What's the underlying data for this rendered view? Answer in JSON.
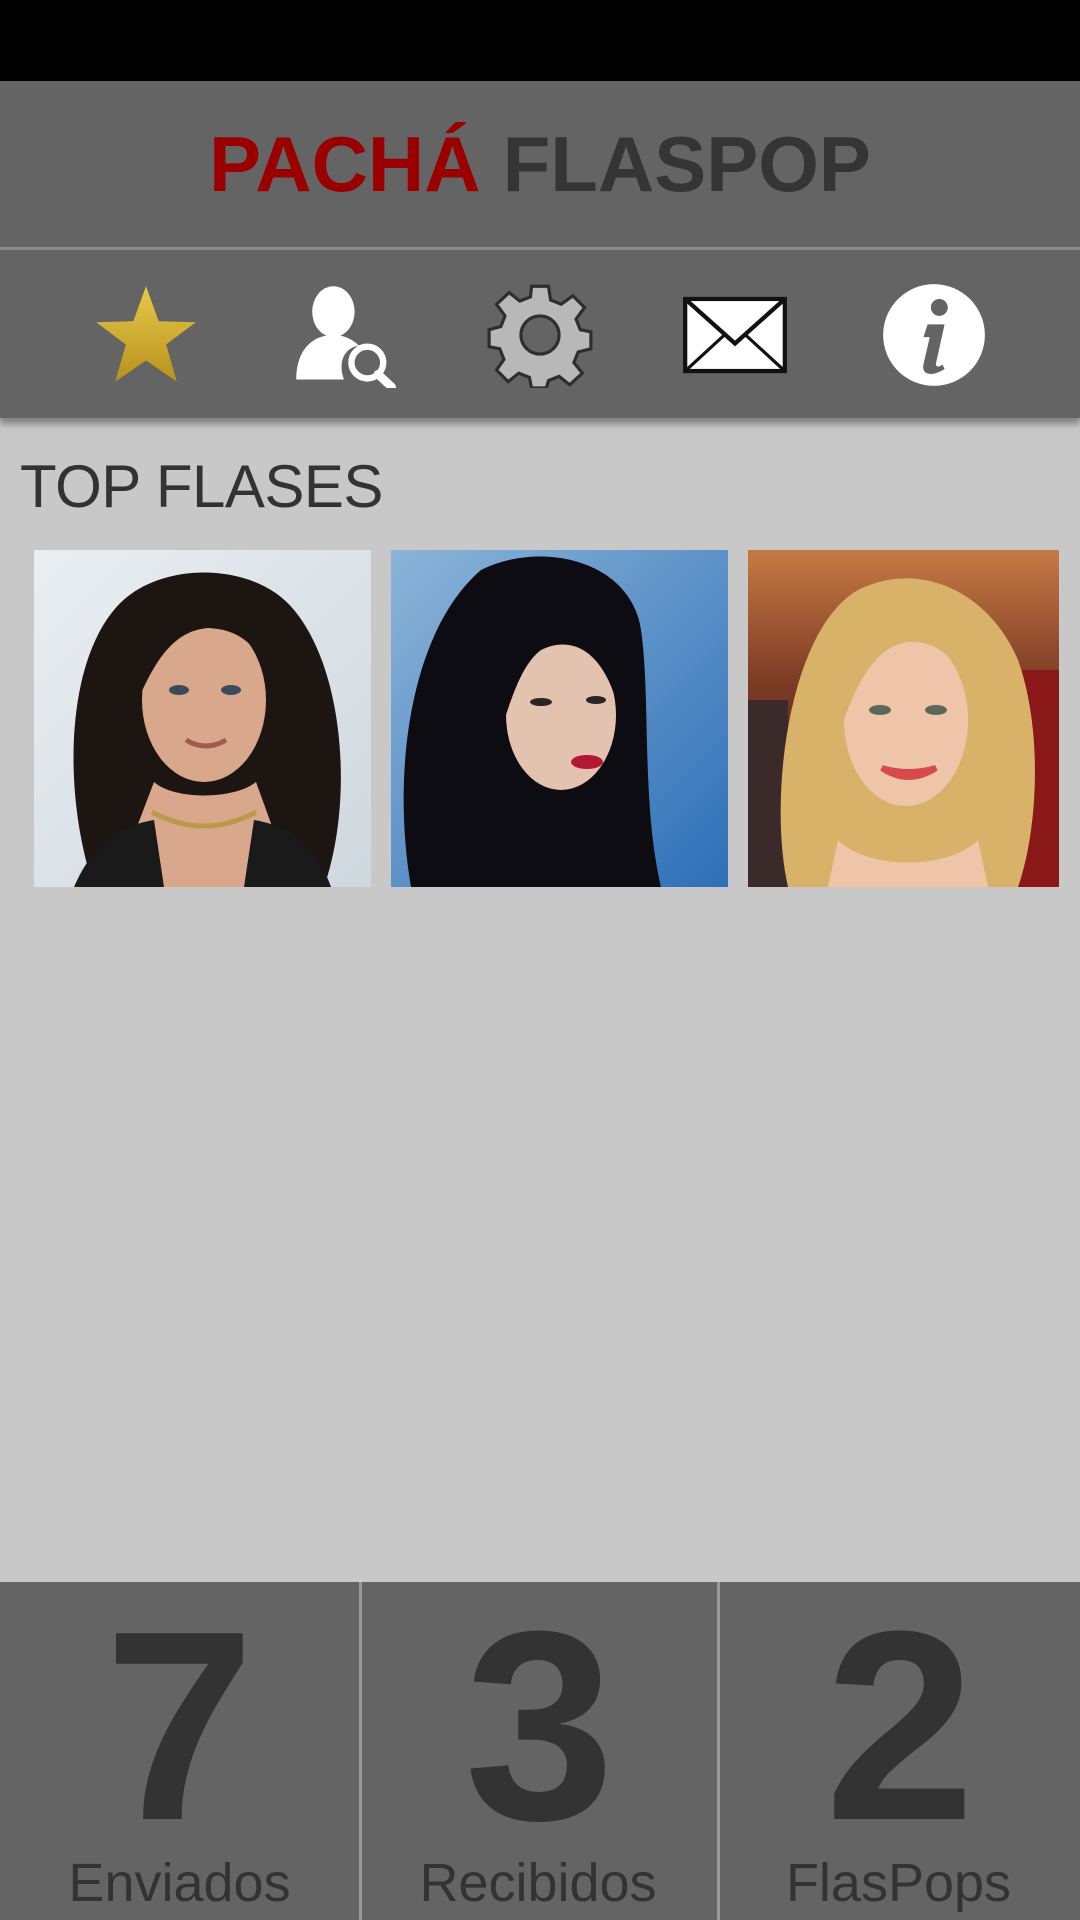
{
  "app": {
    "title_part1": "PACHÁ",
    "title_part2": "FLASPOP",
    "title_part1_color": "#9a0000",
    "title_part2_color": "#353535"
  },
  "toolbar": {
    "icons": [
      "star-icon",
      "user-search-icon",
      "gear-icon",
      "mail-icon",
      "info-icon"
    ],
    "star_color": "#d4b02a"
  },
  "section": {
    "title": "TOP FLASES"
  },
  "photos": [
    {
      "name": "photo-1"
    },
    {
      "name": "photo-2"
    },
    {
      "name": "photo-3"
    }
  ],
  "stats": [
    {
      "value": "7",
      "label": "Enviados"
    },
    {
      "value": "3",
      "label": "Recibidos"
    },
    {
      "value": "2",
      "label": "FlasPops"
    }
  ]
}
